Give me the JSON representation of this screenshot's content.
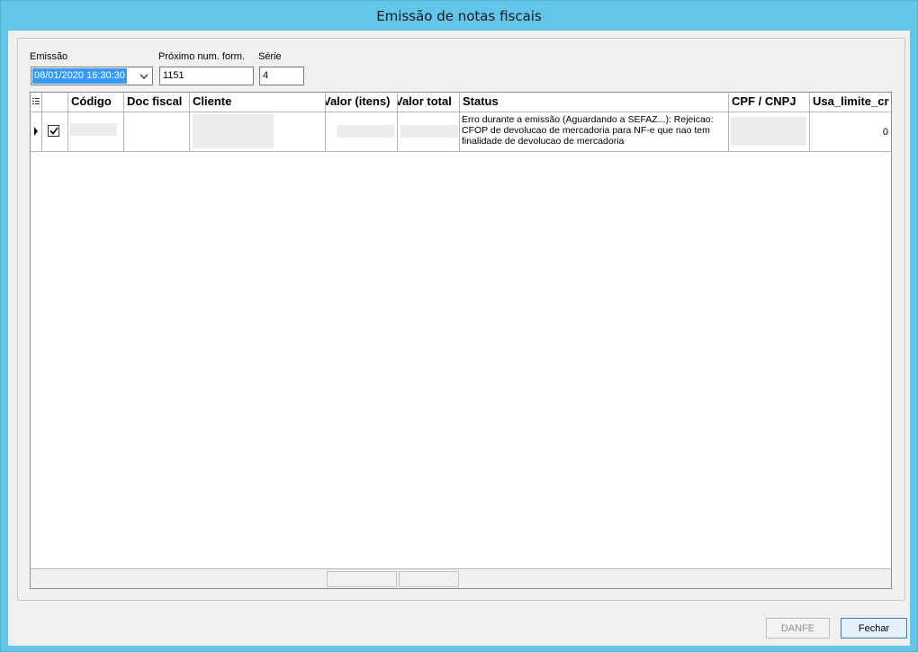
{
  "window": {
    "title": "Emissão de notas fiscais"
  },
  "form": {
    "emissao_label": "Emissão",
    "emissao_value": "08/01/2020 16:30:30",
    "proximo_label": "Próximo num. form.",
    "proximo_value": "1151",
    "serie_label": "Série",
    "serie_value": "4"
  },
  "grid": {
    "columns": [
      "Código",
      "Doc fiscal",
      "Cliente",
      "Valor (itens)",
      "Valor total",
      "Status",
      "CPF / CNPJ",
      "Usa_limite_cr"
    ],
    "rows": [
      {
        "checked": true,
        "status": "Erro durante a emissão (Aguardando a SEFAZ...): Rejeicao: CFOP de devolucao de mercadoria para NF-e que nao tem finalidade de devolucao de mercadoria",
        "usa_limite": "0"
      }
    ]
  },
  "buttons": {
    "danfe": "DANFE",
    "fechar": "Fechar"
  },
  "icons": {
    "row_indicator": "row-pointer-icon",
    "header_menu": "column-chooser-icon",
    "dropdown": "chevron-down-icon",
    "check": "checkmark-icon"
  }
}
